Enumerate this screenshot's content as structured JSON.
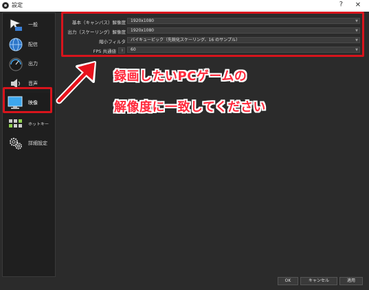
{
  "window": {
    "title": "設定",
    "help_glyph": "?",
    "close_glyph": "✕"
  },
  "sidebar": {
    "items": [
      {
        "label": "一般",
        "icon": "general-icon",
        "selected": false
      },
      {
        "label": "配信",
        "icon": "stream-globe-icon",
        "selected": false
      },
      {
        "label": "出力",
        "icon": "output-gauge-icon",
        "selected": false
      },
      {
        "label": "音声",
        "icon": "audio-speaker-icon",
        "selected": false
      },
      {
        "label": "映像",
        "icon": "video-monitor-icon",
        "selected": true
      },
      {
        "label": "ホットキー",
        "icon": "hotkeys-keyboard-icon",
        "selected": false
      },
      {
        "label": "詳細設定",
        "icon": "advanced-gears-icon",
        "selected": false
      }
    ]
  },
  "video_settings": {
    "base_resolution": {
      "label": "基本（キャンバス）解像度",
      "value": "1920x1080"
    },
    "output_resolution": {
      "label": "出力（スケーリング）解像度",
      "value": "1920x1080"
    },
    "downscale_filter": {
      "label": "縮小フィルタ",
      "value": "バイキュービック（先鋭化スケーリング、16 のサンプル）"
    },
    "fps": {
      "label": "FPS 共通値",
      "value": "60"
    }
  },
  "annotation": {
    "line1": "録画したいPCゲームの",
    "line2": "解像度に一致してください"
  },
  "buttons": {
    "ok": "OK",
    "cancel": "キャンセル",
    "apply": "適用"
  },
  "colors": {
    "accent_red": "#d8141c",
    "annotation_text": "#ff2a3c",
    "panel_bg": "#2b2b2b",
    "sidebar_bg": "#1f1f1f"
  }
}
